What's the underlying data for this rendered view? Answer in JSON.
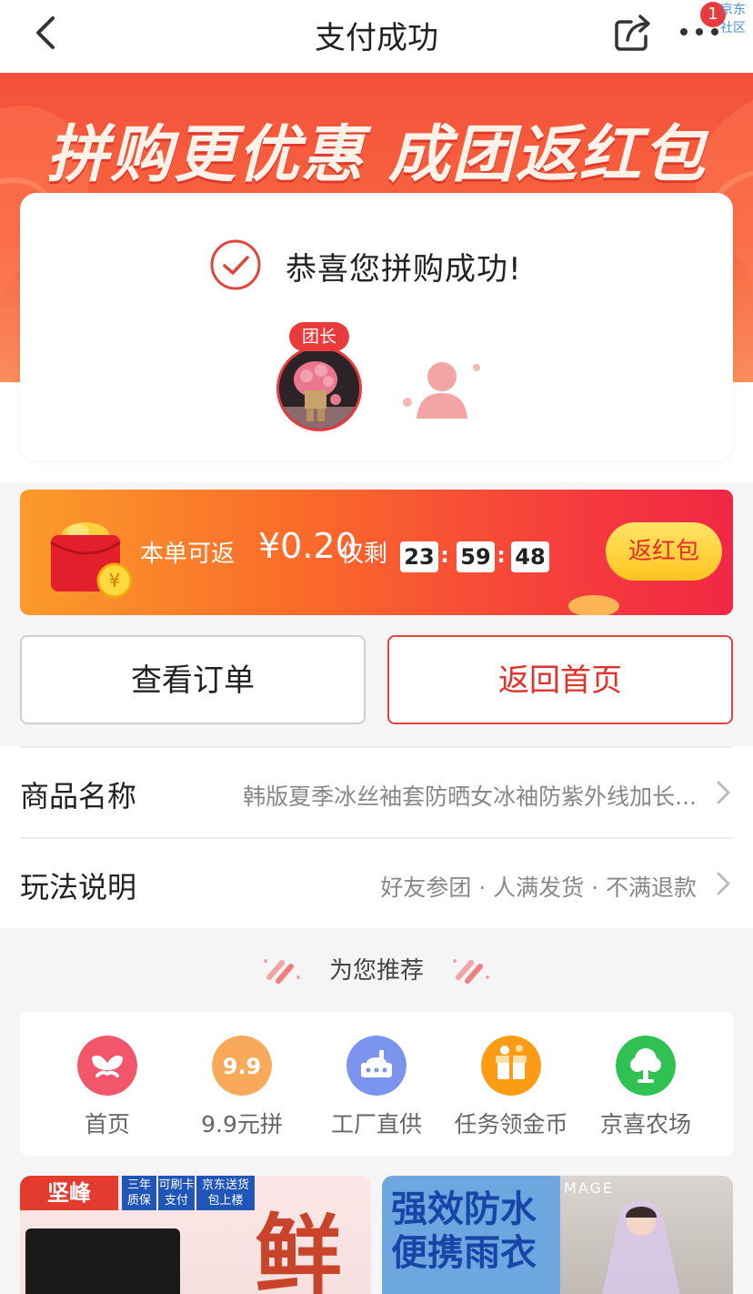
{
  "nav": {
    "title": "支付成功",
    "badge_count": "1",
    "corner_text": "京东社区"
  },
  "hero": {
    "title": "拼购更优惠 成团返红包"
  },
  "success": {
    "message": "恭喜您拼购成功!",
    "leader_tag": "团长"
  },
  "red_packet": {
    "prefix": "本单可返",
    "amount": "¥0.20",
    "remain_label": "仅剩",
    "hours": "23",
    "minutes": "59",
    "seconds": "48",
    "separator": ":",
    "button": "返红包"
  },
  "actions": {
    "view_order": "查看订单",
    "back_home": "返回首页"
  },
  "info": {
    "product_label": "商品名称",
    "product_value": "韩版夏季冰丝袖套防晒女冰袖防紫外线加长...",
    "rules_label": "玩法说明",
    "rules_value": "好友参团 · 人满发货 · 不满退款"
  },
  "recommend": {
    "heading": "为您推荐"
  },
  "quick_nav": [
    {
      "label": "首页",
      "icon": "home-icon",
      "color": "#f2566a",
      "glyph": ""
    },
    {
      "label": "9.9元拼",
      "icon": "nine-nine-icon",
      "color": "#f9a95a",
      "glyph": "9.9"
    },
    {
      "label": "工厂直供",
      "icon": "factory-icon",
      "color": "#7b94ee",
      "glyph": ""
    },
    {
      "label": "任务领金币",
      "icon": "gift-coin-icon",
      "color": "#fb9c14",
      "glyph": ""
    },
    {
      "label": "京喜农场",
      "icon": "tree-icon",
      "color": "#2fc152",
      "glyph": ""
    }
  ],
  "products": {
    "left": {
      "brand": "坚峰",
      "tag1": "三年质保",
      "tag2": "可刷卡支付",
      "tag3": "京东送货包上楼",
      "big_char": "鲜"
    },
    "right": {
      "line1": "强效防水",
      "line2": "便携雨衣",
      "mag": "MAGE"
    }
  }
}
